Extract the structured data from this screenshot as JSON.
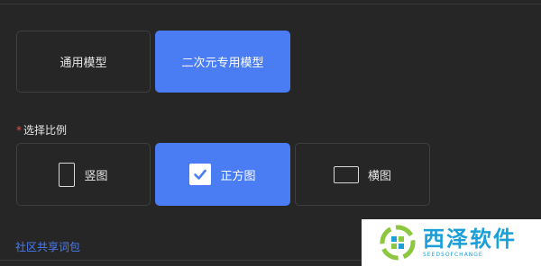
{
  "models": {
    "general": "通用模型",
    "anime": "二次元专用模型"
  },
  "ratio": {
    "required_mark": "*",
    "label": "选择比例",
    "portrait": "竖图",
    "square": "正方图",
    "landscape": "横图",
    "selected": "square"
  },
  "community_link": "社区共享词包",
  "watermark": {
    "main": "西泽软件",
    "sub": "SEEDSOFCHANGE"
  },
  "colors": {
    "accent": "#4a7cf4",
    "background": "#262626",
    "required": "#e34d4d",
    "watermark": "#1a9fd8"
  }
}
